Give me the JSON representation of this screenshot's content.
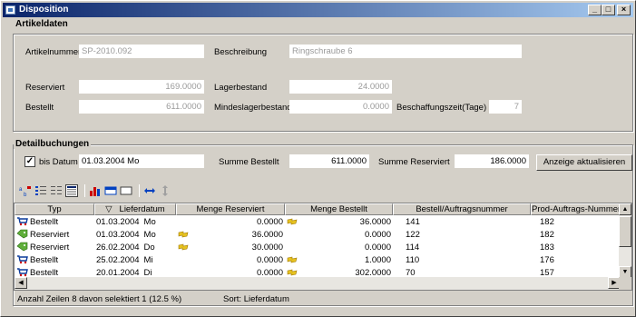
{
  "window": {
    "title": "Disposition"
  },
  "artikeldaten": {
    "group_title": "Artikeldaten",
    "artikelnummer_label": "Artikelnummer",
    "artikelnummer_value": "SP-2010.092",
    "beschreibung_label": "Beschreibung",
    "beschreibung_value": "Ringschraube 6",
    "reserviert_label": "Reserviert",
    "reserviert_value": "169.0000",
    "lagerbestand_label": "Lagerbestand",
    "lagerbestand_value": "24.0000",
    "bestellt_label": "Bestellt",
    "bestellt_value": "611.0000",
    "mindeslager_label": "Mindeslagerbestand",
    "mindeslager_value": "0.0000",
    "beschaffungszeit_label": "Beschaffungszeit(Tage)",
    "beschaffungszeit_value": "7"
  },
  "detail": {
    "group_title": "Detailbuchungen",
    "bis_datum_label": "bis Datum",
    "bis_datum_checked": true,
    "bis_datum_value": "01.03.2004  Mo",
    "summe_bestellt_label": "Summe Bestellt",
    "summe_bestellt_value": "611.0000",
    "summe_reserviert_label": "Summe Reserviert",
    "summe_reserviert_value": "186.0000",
    "refresh_button": "Anzeige aktualisieren"
  },
  "grid": {
    "columns": [
      "Typ",
      "Lieferdatum",
      "Menge Reserviert",
      "Menge Bestellt",
      "Bestell/Auftragsnummer",
      "Prod-Auftrags-Nummer"
    ],
    "sort_indicator": "▽",
    "rows": [
      {
        "typ": "Bestellt",
        "icon": "cart-icon",
        "datum": "01.03.2004",
        "tag": "Mo",
        "res_flag": false,
        "reserviert": "0.0000",
        "best_flag": true,
        "bestellt": "36.0000",
        "nummer": "141",
        "prod": "182"
      },
      {
        "typ": "Reserviert",
        "icon": "tag-icon",
        "datum": "01.03.2004",
        "tag": "Mo",
        "res_flag": true,
        "reserviert": "36.0000",
        "best_flag": false,
        "bestellt": "0.0000",
        "nummer": "122",
        "prod": "182"
      },
      {
        "typ": "Reserviert",
        "icon": "tag-icon",
        "datum": "26.02.2004",
        "tag": "Do",
        "res_flag": true,
        "reserviert": "30.0000",
        "best_flag": false,
        "bestellt": "0.0000",
        "nummer": "114",
        "prod": "183"
      },
      {
        "typ": "Bestellt",
        "icon": "cart-icon",
        "datum": "25.02.2004",
        "tag": "Mi",
        "res_flag": false,
        "reserviert": "0.0000",
        "best_flag": true,
        "bestellt": "1.0000",
        "nummer": "110",
        "prod": "176"
      },
      {
        "typ": "Bestellt",
        "icon": "cart-icon",
        "datum": "20.01.2004",
        "tag": "Di",
        "res_flag": false,
        "reserviert": "0.0000",
        "best_flag": true,
        "bestellt": "302.0000",
        "nummer": "70",
        "prod": "157"
      }
    ]
  },
  "status": {
    "rows_text": "Anzahl Zeilen 8  davon selektiert 1  (12.5 %)",
    "sort_text": "Sort:  Lieferdatum"
  },
  "colors": {
    "title_start": "#0a246a",
    "title_end": "#a6caf0",
    "face": "#d4d0c8"
  }
}
